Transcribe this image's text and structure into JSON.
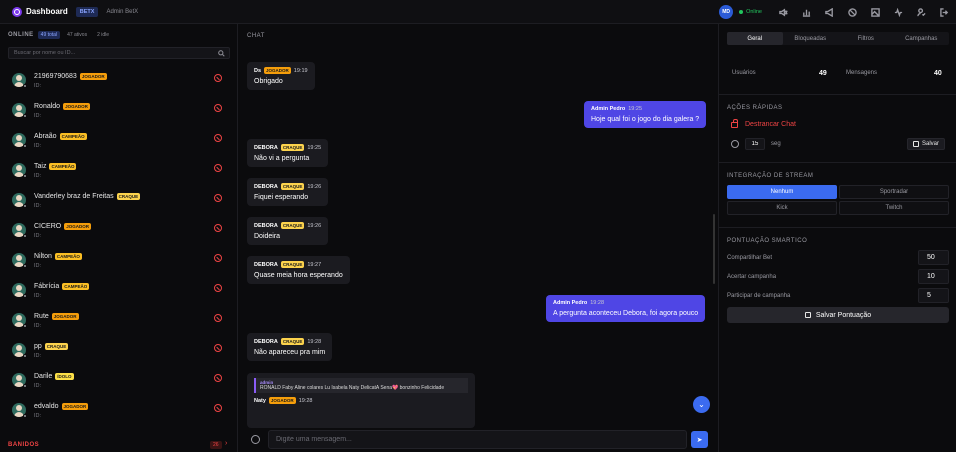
{
  "header": {
    "brand": "Dashboard",
    "tag": "BETX",
    "admin": "Admin BetX",
    "avatar_initials": "MD",
    "status": "Online",
    "icons": [
      "volume-off-icon",
      "bar-chart-icon",
      "megaphone-icon",
      "ban-icon",
      "image-icon",
      "activity-icon",
      "user-check-icon",
      "logout-icon"
    ]
  },
  "left": {
    "online_title": "ONLINE",
    "total": "49 total",
    "active": "47 ativos",
    "idle": "2 idle",
    "search_placeholder": "Buscar por nome ou ID...",
    "users": [
      {
        "name": "21969790683",
        "badge": "JOGADOR",
        "id": "ID:"
      },
      {
        "name": "Ronaldo",
        "badge": "JOGADOR",
        "id": "ID:"
      },
      {
        "name": "Abraão",
        "badge": "CAMPEÃO",
        "id": "ID:"
      },
      {
        "name": "Taiz",
        "badge": "CAMPEÃO",
        "id": "ID:"
      },
      {
        "name": "Vanderley braz de Freitas",
        "badge": "CRAQUE",
        "id": "ID:"
      },
      {
        "name": "CICERO",
        "badge": "JOGADOR",
        "id": "ID:"
      },
      {
        "name": "Nilton",
        "badge": "CAMPEÃO",
        "id": "ID:"
      },
      {
        "name": "Fábrícia",
        "badge": "CAMPEÃO",
        "id": "ID:"
      },
      {
        "name": "Rute",
        "badge": "JOGADOR",
        "id": "ID:"
      },
      {
        "name": "pp",
        "badge": "CRAQUE",
        "id": "ID:"
      },
      {
        "name": "Darile",
        "badge": "ÍDOLO",
        "id": "ID:"
      },
      {
        "name": "edvaldo",
        "badge": "JOGADOR",
        "id": "ID:"
      }
    ],
    "banned_title": "BANIDOS",
    "banned_count": "26"
  },
  "chat": {
    "title": "CHAT",
    "messages": [
      {
        "author": "Ds",
        "badge": "JOGADOR",
        "time": "19:19",
        "text": "Obrigado"
      },
      {
        "author": "Admin Pedro",
        "time": "19:25",
        "text": "Hoje qual foi o jogo do dia galera ?"
      },
      {
        "author": "DEBORA",
        "badge": "CRAQUE",
        "time": "19:25",
        "text": "Não vi a pergunta"
      },
      {
        "author": "DEBORA",
        "badge": "CRAQUE",
        "time": "19:26",
        "text": "Fiquei esperando"
      },
      {
        "author": "DEBORA",
        "badge": "CRAQUE",
        "time": "19:26",
        "text": "Doideira"
      },
      {
        "author": "DEBORA",
        "badge": "CRAQUE",
        "time": "19:27",
        "text": "Quase meia hora esperando"
      },
      {
        "author": "Admin Pedro",
        "time": "19:28",
        "text": "A pergunta aconteceu Debora, foi agora pouco"
      },
      {
        "author": "DEBORA",
        "badge": "CRAQUE",
        "time": "19:28",
        "text": "Não apareceu pra mim"
      },
      {
        "author": "Naty",
        "badge": "JOGADOR",
        "time": "19:28",
        "quote_author": "admin",
        "quote_text": "RONALD Faby Aline colares Lu Isabela Naty DelicatA Sena💖 bonzinho Felicidade"
      }
    ],
    "input_placeholder": "Digite uma mensagem..."
  },
  "right": {
    "tabs": [
      "Geral",
      "Bloqueadas",
      "Filtros",
      "Campanhas"
    ],
    "stats": {
      "users_label": "Usuários",
      "users_value": "49",
      "messages_label": "Mensagens",
      "messages_value": "40"
    },
    "quick_actions_title": "AÇÕES RÁPIDAS",
    "unlock_label": "Destrancar Chat",
    "timer_value": "15",
    "timer_unit": "seg",
    "save_label": "Salvar",
    "stream_title": "INTEGRAÇÃO DE STREAM",
    "stream_options": [
      "Nenhum",
      "Sportradar",
      "Kick",
      "Twitch"
    ],
    "score_title": "PONTUAÇÃO SMARTICO",
    "score_rows": [
      {
        "label": "Compartilhar Bet",
        "value": "50"
      },
      {
        "label": "Acertar campanha",
        "value": "10"
      },
      {
        "label": "Participar de campanha",
        "value": "5"
      }
    ],
    "save_score_label": "Salvar Pontuação"
  },
  "colors": {
    "accent": "#3b6bf0",
    "admin_bubble": "#4f46e5",
    "danger": "#ef4444",
    "online": "#22c55e"
  }
}
